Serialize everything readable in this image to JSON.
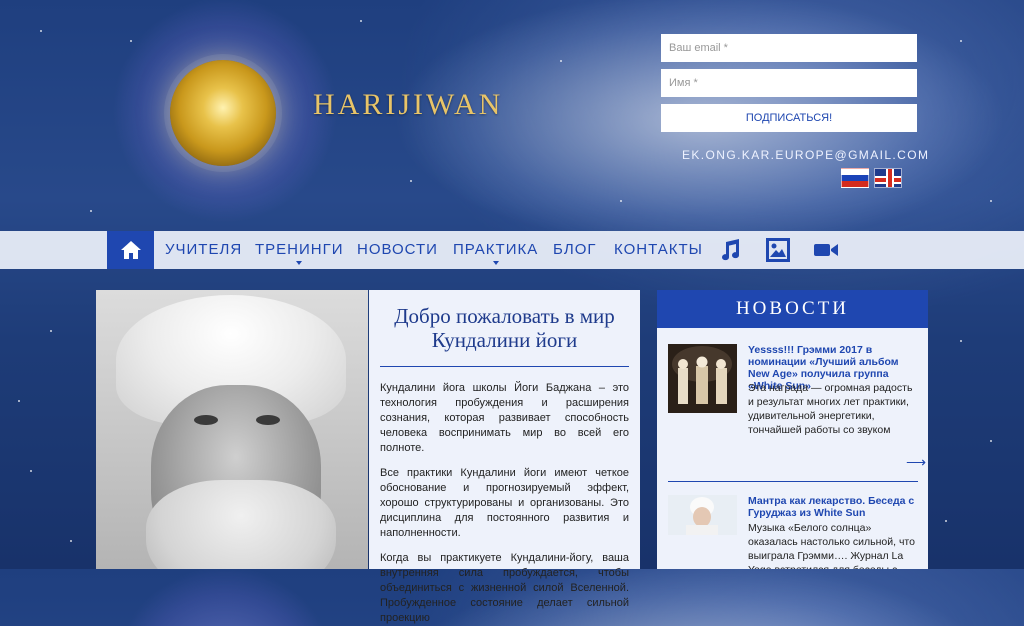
{
  "brand": {
    "name": "HARIJIWAN"
  },
  "subscribe": {
    "email_placeholder": "Ваш email *",
    "name_placeholder": "Имя *",
    "button_label": "ПОДПИСАТЬСЯ!"
  },
  "contact_email": "EK.ONG.KAR.EUROPE@GMAIL.COM",
  "languages": [
    "ru",
    "en"
  ],
  "nav": {
    "home_icon": "home-icon",
    "items": [
      {
        "label": "Учителя",
        "has_dropdown": false
      },
      {
        "label": "Тренинги",
        "has_dropdown": true
      },
      {
        "label": "Новости",
        "has_dropdown": false
      },
      {
        "label": "Практика",
        "has_dropdown": true
      },
      {
        "label": "Блог",
        "has_dropdown": false
      },
      {
        "label": "Контакты",
        "has_dropdown": false
      }
    ],
    "icons": [
      "music-icon",
      "image-gallery-icon",
      "video-icon"
    ]
  },
  "welcome": {
    "title": "Добро пожаловать в мир Кундалини йоги",
    "paragraphs": [
      "Кундалини йога школы Йоги Баджана – это технология пробуждения и расширения сознания, которая развивает способность человека воспринимать мир во всей его полноте.",
      "Все практики Кундалини йоги имеют четкое обоснование и прогнозируемый эффект, хорошо структурированы и организованы. Это дисциплина для постоянного развития и наполненности.",
      "Когда вы практикуете Кундалини-йогу, ваша внутренняя сила пробуждается, чтобы объединиться с жизненной силой Вселенной. Пробужденное состояние делает сильной проекцию"
    ]
  },
  "news": {
    "heading": "НОВОСТИ",
    "items": [
      {
        "title": "Yessss!!! Грэмми 2017 в номинации «Лучший альбом New Age» получила группа «White Sun»",
        "text": "Эта награда — огромная радость и результат многих лет практики, удивительной энергетики, тончайшей работы со звуком"
      },
      {
        "title": "Мантра как лекарство. Беседа с Гуруджаз из White Sun",
        "text": "Музыка «Белого солнца» оказалась настолько сильной, что выиграла Грэмми…. Журнал La Yoga встретился для беседы с Гуруджаз"
      }
    ],
    "more_icon": "arrow-right-icon"
  },
  "colors": {
    "accent": "#1f47b0",
    "brand_gold": "#e8c468",
    "panel_bg": "#eef2fb"
  }
}
